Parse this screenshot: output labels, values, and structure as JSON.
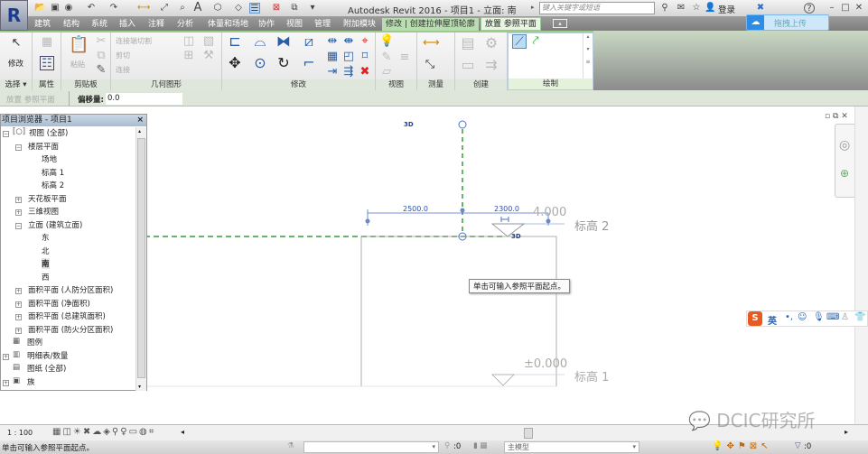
{
  "app": {
    "title": "Autodesk Revit 2016 -     项目1 - 立面: 南",
    "logo": "R"
  },
  "titlebar": {
    "search_placeholder": "键入关键字或短语",
    "login": "登录",
    "upload_label": "拖拽上传"
  },
  "tabs": [
    "建筑",
    "结构",
    "系统",
    "插入",
    "注释",
    "分析",
    "体量和场地",
    "协作",
    "视图",
    "管理",
    "附加模块",
    "修改 | 创建拉伸屋顶轮廓",
    "放置 参照平面"
  ],
  "ribbon": {
    "modify_label": "修改",
    "paste_label": "粘贴",
    "geometry_items": [
      "连接端切割",
      "剪切",
      "连接"
    ],
    "panels": [
      "选择 ▾",
      "属性",
      "剪贴板",
      "几何图形",
      "修改",
      "视图",
      "测量",
      "创建",
      "绘制"
    ]
  },
  "options_bar": {
    "context": "放置 参照平面",
    "offset_label": "偏移量:",
    "offset_value": "0.0"
  },
  "browser": {
    "title": "项目浏览器 - 项目1",
    "close": "×",
    "items": [
      {
        "label": "视图 (全部)",
        "level": 0
      },
      {
        "label": "楼层平面",
        "level": 1
      },
      {
        "label": "场地",
        "level": 2
      },
      {
        "label": "标高 1",
        "level": 2
      },
      {
        "label": "标高 2",
        "level": 2
      },
      {
        "label": "天花板平面",
        "level": 1
      },
      {
        "label": "三维视图",
        "level": 1
      },
      {
        "label": "立面 (建筑立面)",
        "level": 1
      },
      {
        "label": "东",
        "level": 2
      },
      {
        "label": "北",
        "level": 2
      },
      {
        "label": "南",
        "level": 2
      },
      {
        "label": "西",
        "level": 2
      },
      {
        "label": "面积平面 (人防分区面积)",
        "level": 1
      },
      {
        "label": "面积平面 (净面积)",
        "level": 1
      },
      {
        "label": "面积平面 (总建筑面积)",
        "level": 1
      },
      {
        "label": "面积平面 (防火分区面积)",
        "level": 1
      },
      {
        "label": "图例",
        "level": 0
      },
      {
        "label": "明细表/数量",
        "level": 0
      },
      {
        "label": "图纸 (全部)",
        "level": 0
      },
      {
        "label": "族",
        "level": 0
      }
    ]
  },
  "drawing": {
    "dim1": "2500.0",
    "dim2": "2300.0",
    "level2_elev": "4.000",
    "level2_name": "标高 2",
    "level1_elev": "±0.000",
    "level1_name": "标高 1",
    "tag_3d": "3D",
    "tooltip": "单击可输入参照平面起点。",
    "ime_lang": "英"
  },
  "view_control": {
    "scale": "1 : 100"
  },
  "status": {
    "message": "单击可输入参照平面起点。",
    "sel_count": ":0",
    "model": "主模型",
    "filter_count": ":0"
  },
  "watermark": "DCIC研究所",
  "colors": {
    "accent_green": "#9ccc8a",
    "ref_plane": "#3a9a3a",
    "dim_blue": "#4a6fd0"
  }
}
